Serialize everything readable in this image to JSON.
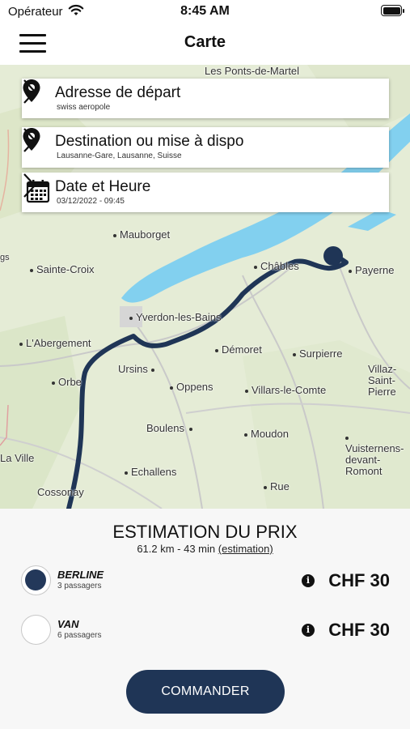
{
  "status_bar": {
    "carrier": "Opérateur",
    "time": "8:45 AM"
  },
  "nav": {
    "title": "Carte",
    "menu_icon": "hamburger-menu-icon"
  },
  "map": {
    "places": [
      "Les Ponts-de-Martel",
      "Mauborget",
      "Sainte-Croix",
      "Châbles",
      "Payerne",
      "Yverdon-les-Bains",
      "L'Abergement",
      "Démoret",
      "Surpierre",
      "Ursins",
      "Villaz-Saint-Pierre",
      "Orbe",
      "Oppens",
      "Villars-le-Comte",
      "Boulens",
      "Moudon",
      "Vuisternens-devant-Romont",
      "La Ville",
      "Echallens",
      "Rue",
      "Cossonay",
      "gs"
    ],
    "route_color": "#1f3556",
    "lake_color": "#7fd0f0"
  },
  "cards": {
    "departure": {
      "title": "Adresse de départ",
      "subtitle": "swiss aeropole"
    },
    "destination": {
      "title": "Destination ou mise à dispo",
      "subtitle": "Lausanne-Gare, Lausanne, Suisse"
    },
    "datetime": {
      "title": "Date et Heure",
      "subtitle": "03/12/2022 - 09:45"
    }
  },
  "estimate": {
    "title": "ESTIMATION DU PRIX",
    "summary": "61.2 km - 43 min",
    "link": "(estimation)",
    "options": [
      {
        "name": "BERLINE",
        "passengers": "3 passagers",
        "price": "CHF 30",
        "selected": true
      },
      {
        "name": "VAN",
        "passengers": "6 passagers",
        "price": "CHF 30",
        "selected": false
      }
    ],
    "info_glyph": "i",
    "order_label": "COMMANDER"
  }
}
